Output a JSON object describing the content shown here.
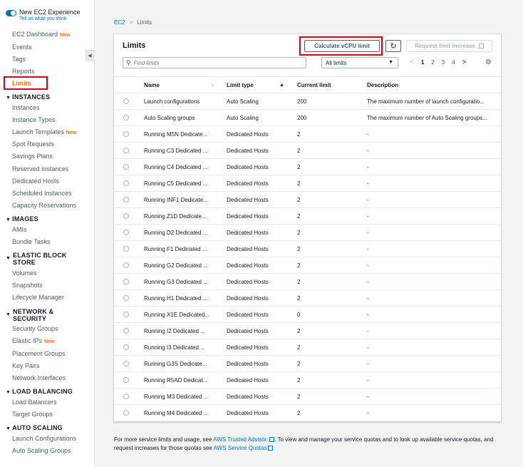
{
  "sidebar": {
    "experience_title": "New EC2 Experience",
    "experience_link": "Tell us what you think",
    "new_badge": "New",
    "top_items": [
      {
        "label": "EC2 Dashboard",
        "badge": "New"
      },
      {
        "label": "Events"
      },
      {
        "label": "Tags"
      },
      {
        "label": "Reports"
      },
      {
        "label": "Limits"
      }
    ],
    "sections": [
      {
        "title": "INSTANCES",
        "items": [
          "Instances",
          "Instance Types",
          "Launch Templates",
          "Spot Requests",
          "Savings Plans",
          "Reserved Instances",
          "Dedicated Hosts",
          "Scheduled Instances",
          "Capacity Reservations"
        ]
      },
      {
        "title": "IMAGES",
        "items": [
          "AMIs",
          "Bundle Tasks"
        ]
      },
      {
        "title": "ELASTIC BLOCK STORE",
        "items": [
          "Volumes",
          "Snapshots",
          "Lifecycle Manager"
        ]
      },
      {
        "title": "NETWORK & SECURITY",
        "items": [
          "Security Groups",
          "Elastic IPs",
          "Placement Groups",
          "Key Pairs",
          "Network Interfaces"
        ]
      },
      {
        "title": "LOAD BALANCING",
        "items": [
          "Load Balancers",
          "Target Groups"
        ]
      },
      {
        "title": "AUTO SCALING",
        "items": [
          "Launch Configurations",
          "Auto Scaling Groups"
        ]
      }
    ],
    "items_with_new": [
      "Launch Templates",
      "Elastic IPs"
    ]
  },
  "breadcrumb": {
    "root": "EC2",
    "current": "Limits"
  },
  "panel": {
    "title": "Limits",
    "calculate_button": "Calculate vCPU limit",
    "request_button": "Request limit increase",
    "search_placeholder": "Find limits",
    "filter_selected": "All limits",
    "pages": [
      "1",
      "2",
      "3",
      "4"
    ],
    "current_page": "1"
  },
  "table": {
    "columns": [
      "Name",
      "Limit type",
      "Current limit",
      "Description"
    ],
    "rows": [
      [
        "Launch configurations",
        "Auto Scaling",
        "200",
        "The maximum number of launch configuratio..."
      ],
      [
        "Auto Scaling groups",
        "Auto Scaling",
        "200",
        "The maximum number of Auto Scaling groups..."
      ],
      [
        "Running M5N Dedicate...",
        "Dedicated Hosts",
        "2",
        "-"
      ],
      [
        "Running C3 Dedicated ...",
        "Dedicated Hosts",
        "2",
        "-"
      ],
      [
        "Running C4 Dedicated ...",
        "Dedicated Hosts",
        "2",
        "-"
      ],
      [
        "Running C5 Dedicated ...",
        "Dedicated Hosts",
        "2",
        "-"
      ],
      [
        "Running INF1 Dedicate...",
        "Dedicated Hosts",
        "2",
        "-"
      ],
      [
        "Running Z1D Dedicate...",
        "Dedicated Hosts",
        "2",
        "-"
      ],
      [
        "Running D2 Dedicated ...",
        "Dedicated Hosts",
        "2",
        "-"
      ],
      [
        "Running F1 Dedicated ...",
        "Dedicated Hosts",
        "2",
        "-"
      ],
      [
        "Running G2 Dedicated ...",
        "Dedicated Hosts",
        "2",
        "-"
      ],
      [
        "Running G3 Dedicated ...",
        "Dedicated Hosts",
        "2",
        "-"
      ],
      [
        "Running H1 Dedicated ...",
        "Dedicated Hosts",
        "2",
        "-"
      ],
      [
        "Running X1E Dedicated...",
        "Dedicated Hosts",
        "0",
        "-"
      ],
      [
        "Running I2 Dedicated ...",
        "Dedicated Hosts",
        "2",
        "-"
      ],
      [
        "Running I3 Dedicated ...",
        "Dedicated Hosts",
        "2",
        "-"
      ],
      [
        "Running G3S Dedicate...",
        "Dedicated Hosts",
        "2",
        "-"
      ],
      [
        "Running R5AD Dedicat...",
        "Dedicated Hosts",
        "2",
        "-"
      ],
      [
        "Running M3 Dedicated ...",
        "Dedicated Hosts",
        "2",
        "-"
      ],
      [
        "Running M4 Dedicated ...",
        "Dedicated Hosts",
        "2",
        "-"
      ]
    ]
  },
  "footer": {
    "text_1": "For more service limits and usage, see ",
    "link_1": "AWS Trusted Advisor.",
    "text_2": ". To view and manage your service quotas and to look up available service quotas, and request increases for those quotas see ",
    "link_2": "AWS Service Quotas"
  },
  "colors": {
    "accent": "#0073bb",
    "active": "#ec7211",
    "highlight": "#d0021b"
  }
}
